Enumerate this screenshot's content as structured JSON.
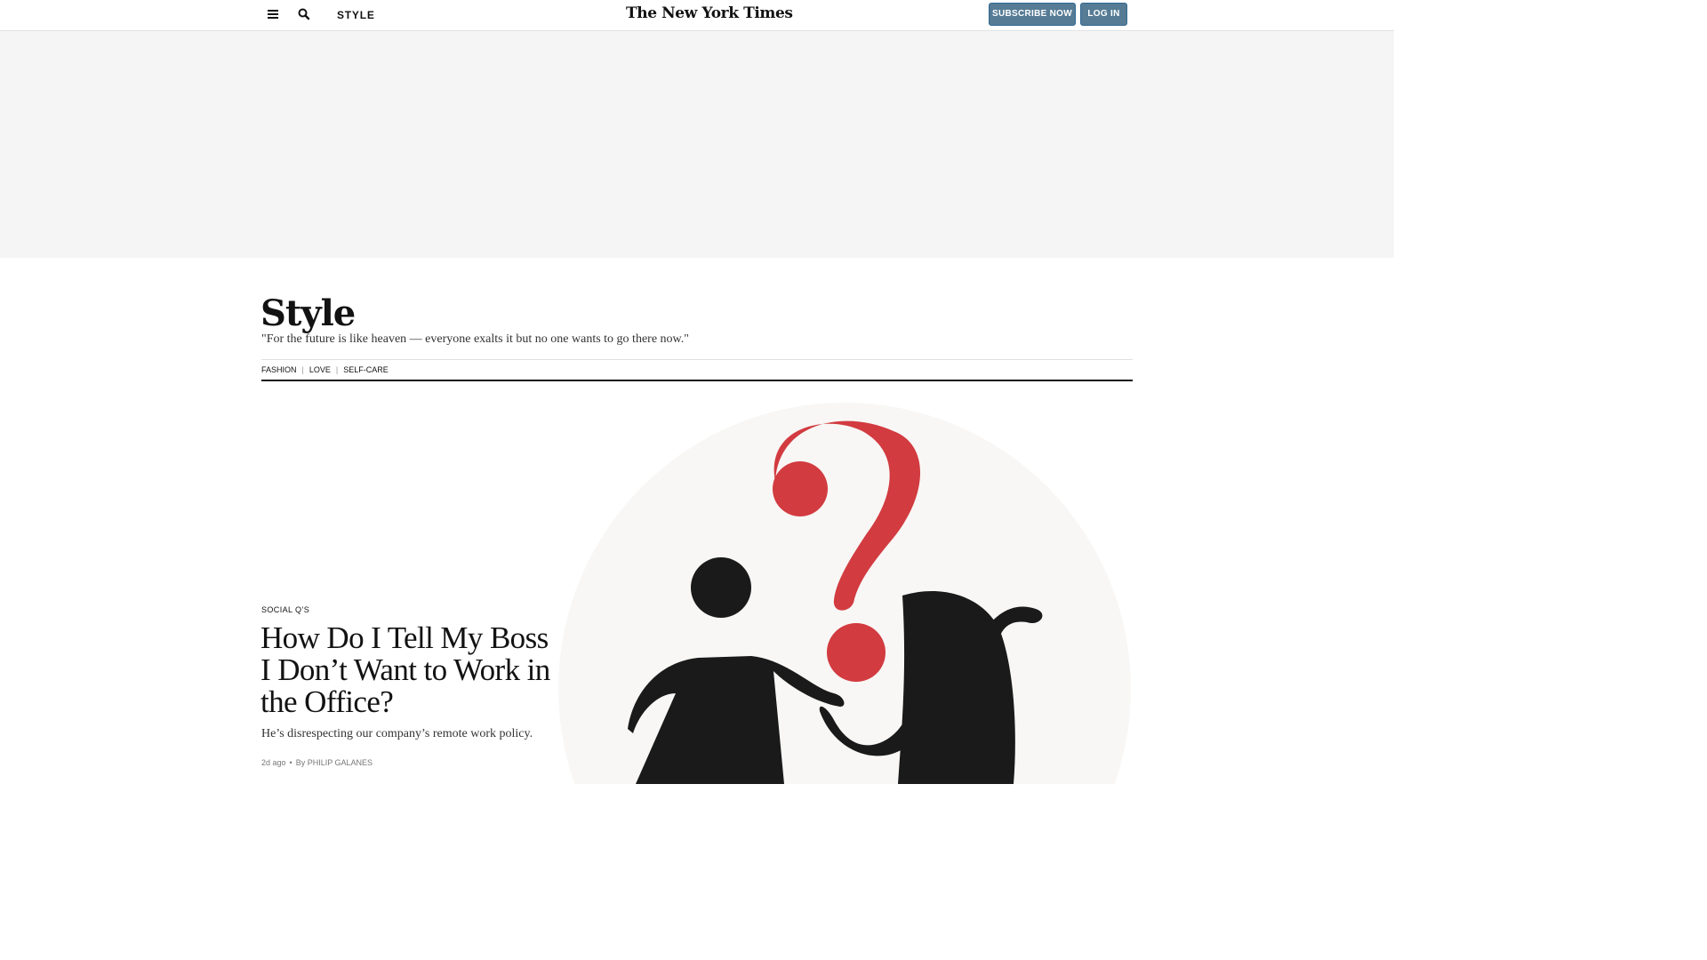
{
  "header": {
    "section_label": "STYLE",
    "logo_text": "The New York Times",
    "subscribe_label": "SUBSCRIBE NOW",
    "login_label": "LOG IN",
    "accent_color": "#567b95"
  },
  "section": {
    "title": "Style",
    "quote": "\"For the future is like heaven — everyone exalts it but no one wants to go there now.\"",
    "subnav": [
      "FASHION",
      "LOVE",
      "SELF-CARE"
    ]
  },
  "story": {
    "kicker": "SOCIAL Q’S",
    "headline": "How Do I Tell My Boss I Don’t Want to Work in the Office?",
    "summary": "He’s disrespecting our company’s remote work policy.",
    "time": "2d ago",
    "byline": "By PHILIP GALANES",
    "illustration_colors": {
      "question_mark": "#d23b40",
      "figures": "#1a1a1a",
      "circle": "#f8f7f5"
    }
  },
  "icons": {
    "menu": "menu-icon",
    "search": "search-icon"
  }
}
